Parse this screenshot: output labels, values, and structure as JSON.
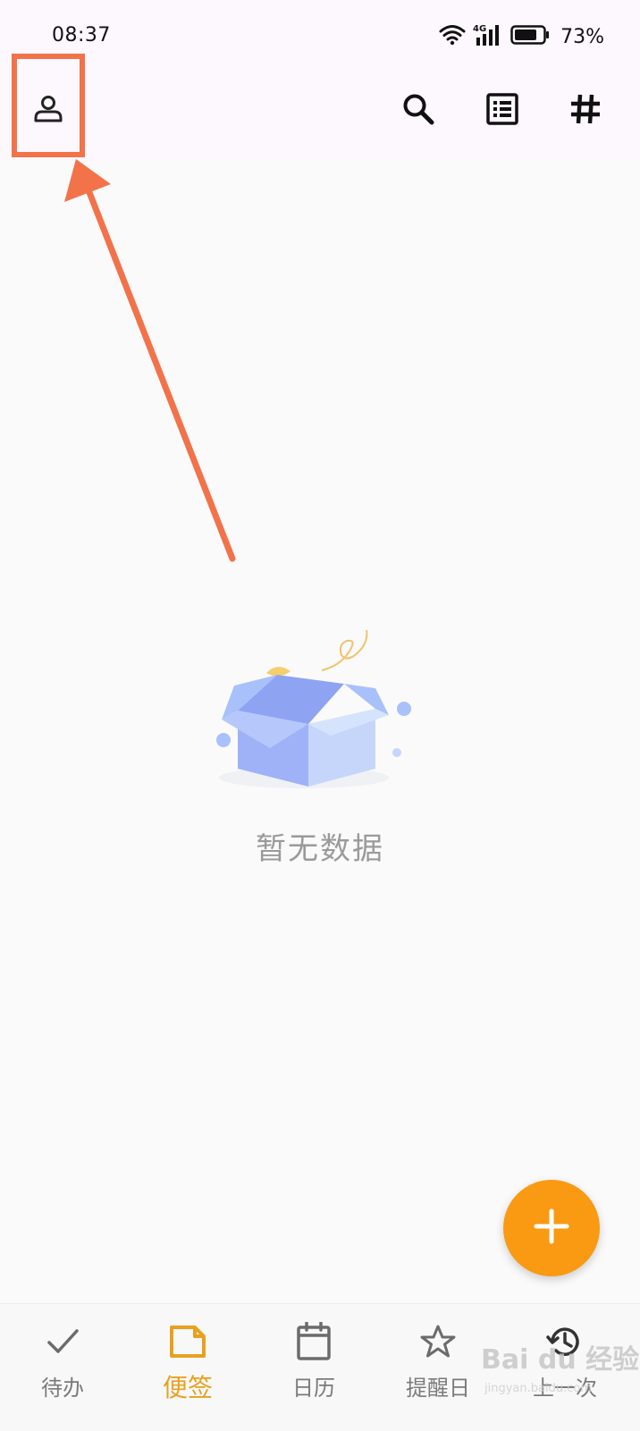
{
  "status_bar": {
    "time": "08:37",
    "network": "4G",
    "battery_percent": "73%"
  },
  "toolbar": {
    "icons": [
      "user-icon",
      "search-icon",
      "list-icon",
      "hash-icon"
    ]
  },
  "empty_state": {
    "message": "暂无数据"
  },
  "fab": {
    "icon": "plus-icon",
    "color": "#f99a12"
  },
  "bottom_nav": {
    "items": [
      {
        "label": "待办",
        "icon": "check-icon",
        "active": false
      },
      {
        "label": "便签",
        "icon": "note-icon",
        "active": true
      },
      {
        "label": "日历",
        "icon": "calendar-icon",
        "active": false
      },
      {
        "label": "提醒日",
        "icon": "star-icon",
        "active": false
      },
      {
        "label": "上一次",
        "icon": "history-icon",
        "active": false
      }
    ],
    "active_color": "#e9a020"
  },
  "annotation": {
    "color": "#f2724a"
  },
  "watermark": {
    "text": "Bai du 经验",
    "sub": "jingyan.baidu.com"
  }
}
